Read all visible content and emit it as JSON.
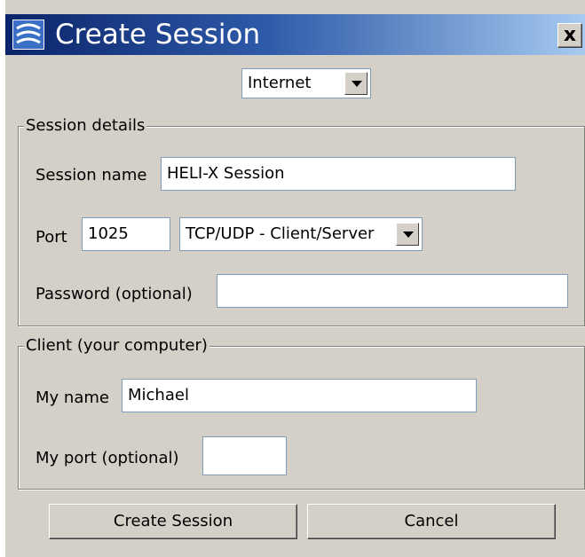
{
  "window": {
    "title": "Create Session",
    "icons": {
      "app": "app-logo-icon",
      "close": "close-icon",
      "dropdown": "chevron-down-icon"
    },
    "close_label": "x"
  },
  "connection": {
    "mode": "Internet"
  },
  "session_details": {
    "legend": "Session details",
    "name_label": "Session name",
    "name_value": "HELI-X Session",
    "port_label": "Port",
    "port_value": "1025",
    "protocol": "TCP/UDP - Client/Server",
    "password_label": "Password (optional)",
    "password_value": ""
  },
  "client": {
    "legend": "Client (your computer)",
    "name_label": "My name",
    "name_value": "Michael",
    "port_label": "My port (optional)",
    "port_value": ""
  },
  "buttons": {
    "create": "Create Session",
    "cancel": "Cancel"
  }
}
